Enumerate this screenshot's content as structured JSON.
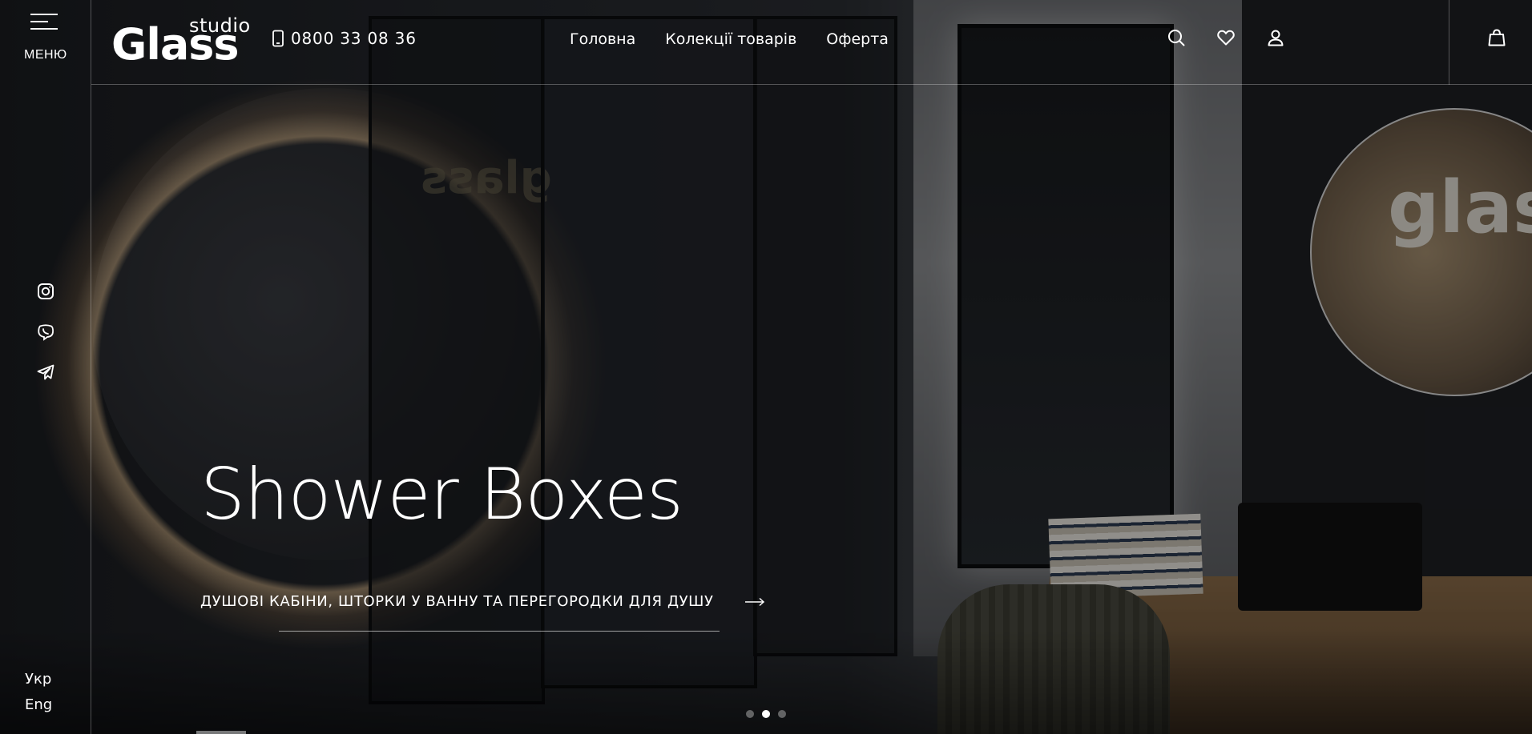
{
  "rail": {
    "menu_label": "МЕНЮ",
    "social": [
      {
        "icon": "instagram-icon"
      },
      {
        "icon": "viber-icon"
      },
      {
        "icon": "telegram-icon"
      }
    ],
    "languages": [
      "Укр",
      "Eng"
    ]
  },
  "header": {
    "logo_small": "studio",
    "logo_big": "Glass",
    "phone": "0800 33 08 36",
    "nav": [
      "Головна",
      "Колекції товарів",
      "Оферта"
    ],
    "icons": [
      "search-icon",
      "heart-icon",
      "user-icon",
      "cart-icon"
    ]
  },
  "hero": {
    "title": "Shower Boxes",
    "subtitle": "ДУШОВІ КАБІНИ, ШТОРКИ У ВАННУ ТА ПЕРЕГОРОДКИ ДЛЯ ДУШУ",
    "slides_total": 3,
    "active_slide": 2
  }
}
